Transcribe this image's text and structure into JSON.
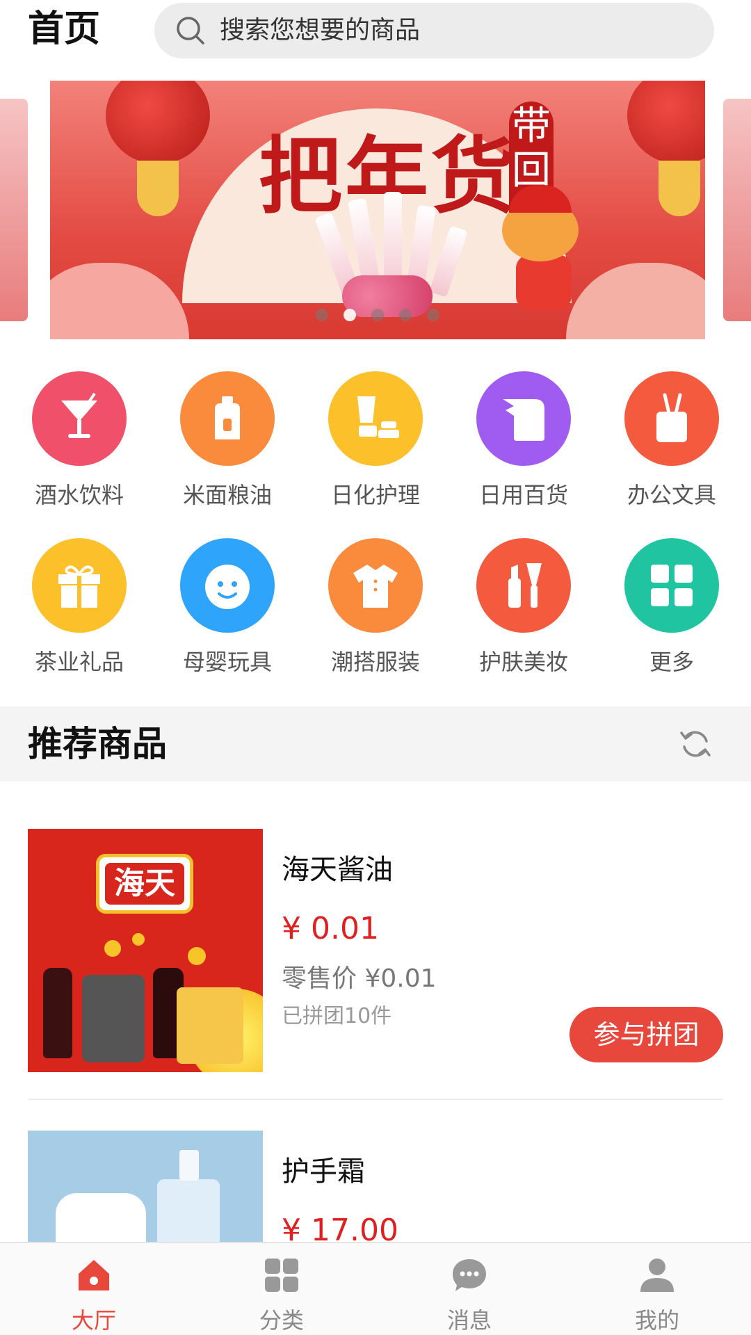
{
  "header": {
    "title": "首页",
    "search_placeholder": "搜索您想要的商品"
  },
  "banner": {
    "headline": "把年货",
    "tagline": "带回家",
    "slide_count": 5,
    "active_slide": 2
  },
  "categories": [
    {
      "label": "酒水饮料",
      "icon": "cocktail-icon",
      "color": "#f0506a"
    },
    {
      "label": "米面粮油",
      "icon": "oil-bottle-icon",
      "color": "#fb8b3c"
    },
    {
      "label": "日化护理",
      "icon": "skincare-icon",
      "color": "#fcc02a"
    },
    {
      "label": "日用百货",
      "icon": "tissue-roll-icon",
      "color": "#a05cf0"
    },
    {
      "label": "办公文具",
      "icon": "pen-holder-icon",
      "color": "#f35a3e"
    },
    {
      "label": "茶业礼品",
      "icon": "gift-icon",
      "color": "#fcc02a"
    },
    {
      "label": "母婴玩具",
      "icon": "baby-face-icon",
      "color": "#2ea4fb"
    },
    {
      "label": "潮搭服装",
      "icon": "shirt-icon",
      "color": "#fb8b3c"
    },
    {
      "label": "护肤美妆",
      "icon": "makeup-icon",
      "color": "#f35a3e"
    },
    {
      "label": "更多",
      "icon": "grid-more-icon",
      "color": "#20c4a0"
    }
  ],
  "section": {
    "title": "推荐商品",
    "refresh_icon": "refresh-icon"
  },
  "products": [
    {
      "name": "海天酱油",
      "price": "¥ 0.01",
      "retail": "零售价 ¥0.01",
      "sold": "已拼团10件",
      "button": "参与拼团",
      "brand_text": "海天"
    },
    {
      "name": "护手霜",
      "price": "¥ 17.00"
    }
  ],
  "tabbar": {
    "items": [
      {
        "label": "大厅",
        "icon": "home-icon",
        "active": true
      },
      {
        "label": "分类",
        "icon": "category-icon",
        "active": false
      },
      {
        "label": "消息",
        "icon": "message-icon",
        "active": false
      },
      {
        "label": "我的",
        "icon": "profile-icon",
        "active": false
      }
    ]
  },
  "colors": {
    "accent": "#e8473c",
    "price": "#e02020"
  }
}
